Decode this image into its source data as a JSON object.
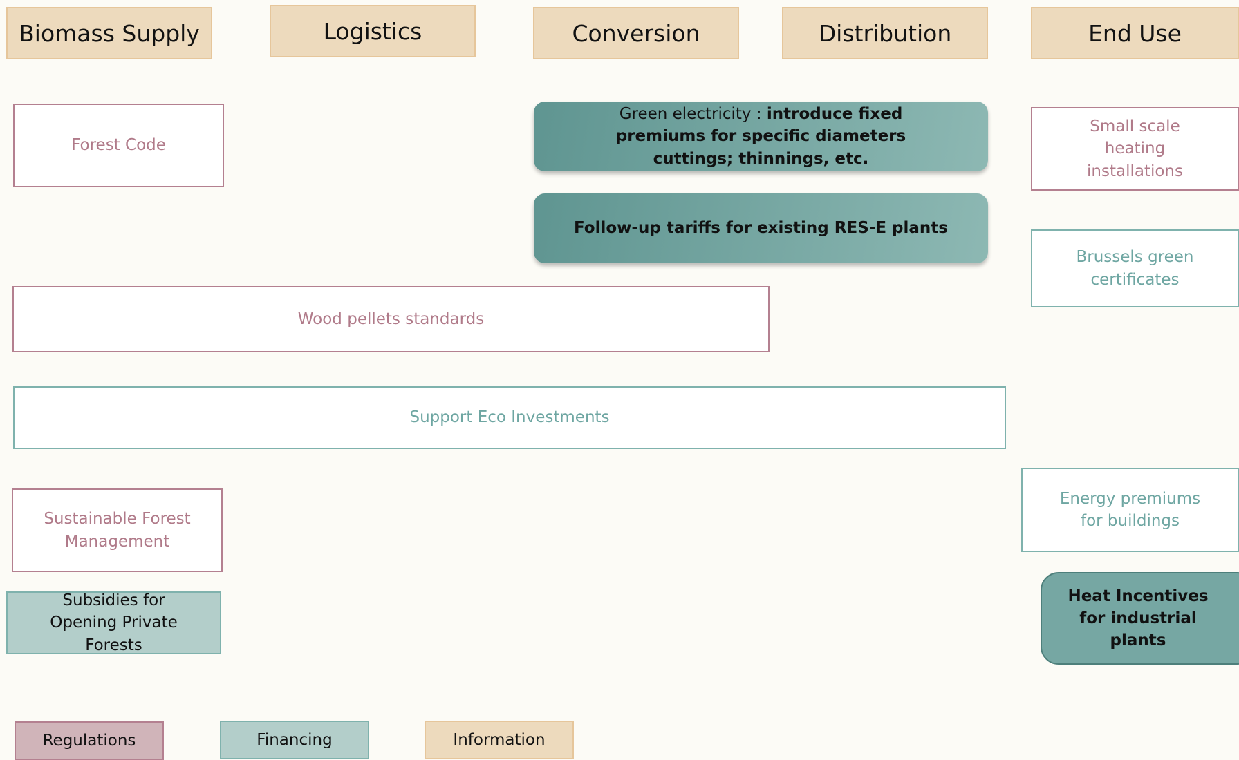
{
  "headers": [
    "Biomass Supply",
    "Logistics",
    "Conversion",
    "Distribution",
    "End Use"
  ],
  "measures": {
    "forest_code": "Forest Code",
    "green_electricity_prefix": "Green electricity : ",
    "green_electricity_bold": "introduce fixed premiums for specific diameters cuttings; thinnings, etc.",
    "follow_up_tariffs": "Follow-up tariffs for existing RES-E plants",
    "small_scale_heating": "Small scale heating installations",
    "brussels_green_certificates": "Brussels green certificates",
    "wood_pellets_standards": "Wood pellets standards",
    "support_eco_investments": "Support Eco Investments",
    "sustainable_forest_management": "Sustainable Forest Management",
    "energy_premiums_buildings": "Energy premiums for buildings",
    "subsidies_private_forests": "Subsidies for Opening Private Forests",
    "heat_incentives": "Heat Incentives for industrial plants"
  },
  "legend": {
    "regulations": "Regulations",
    "financing": "Financing",
    "information": "Information"
  },
  "colors": {
    "background": "#fcfbf6",
    "information": "#eddabd",
    "regulations": "#d0b4b9",
    "financing": "#b3ceca",
    "financing_strong": "#76a7a3"
  }
}
